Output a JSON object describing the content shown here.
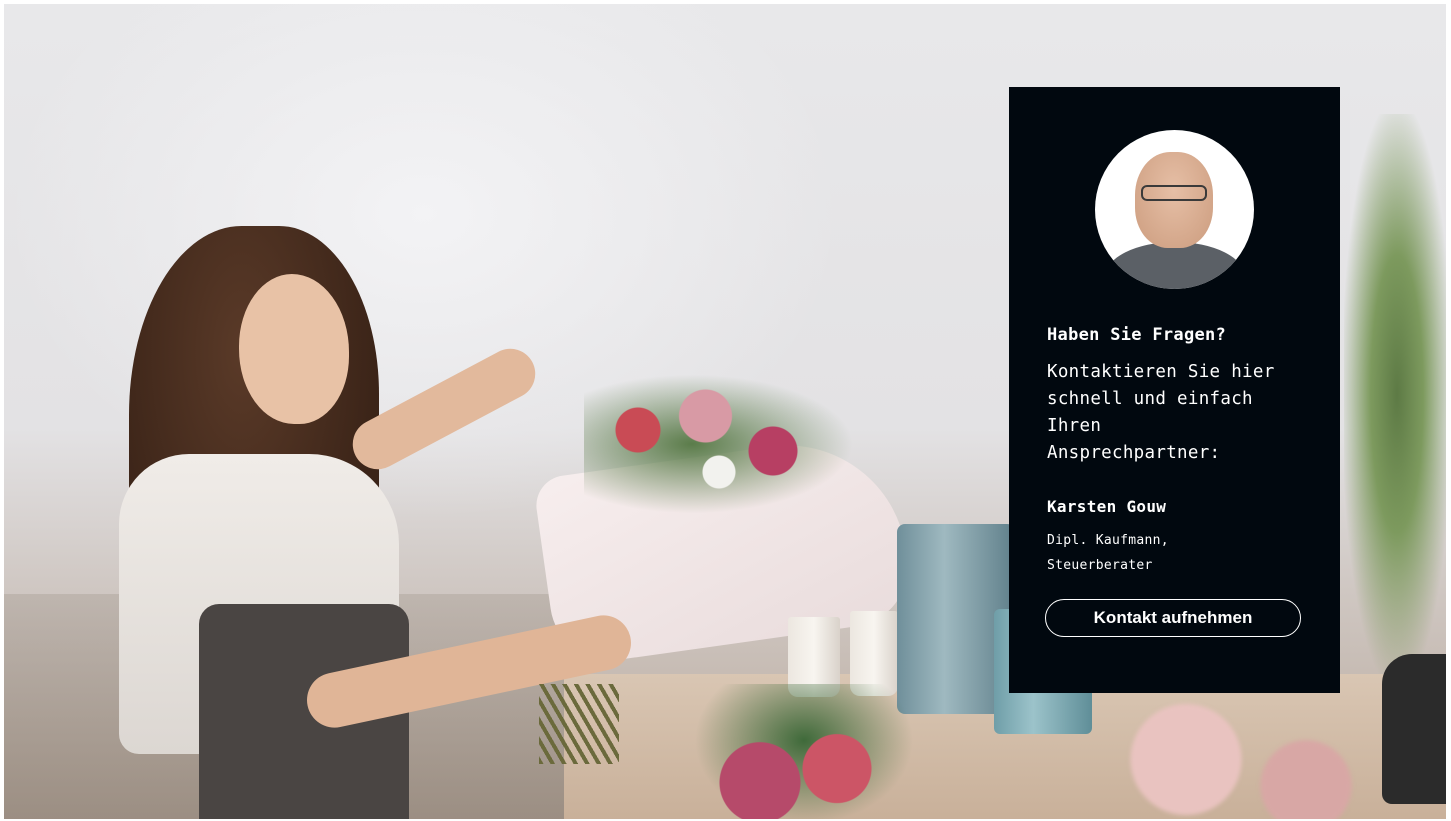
{
  "contact": {
    "heading": "Haben Sie Fragen?",
    "text": "Kontaktieren Sie hier schnell und einfach Ihren Ansprechpartner:",
    "name": "Karsten Gouw",
    "role": "Dipl. Kaufmann, Steuerberater",
    "button_label": "Kontakt aufnehmen",
    "colors": {
      "card_background": "#01080f",
      "text": "#ffffff"
    }
  }
}
